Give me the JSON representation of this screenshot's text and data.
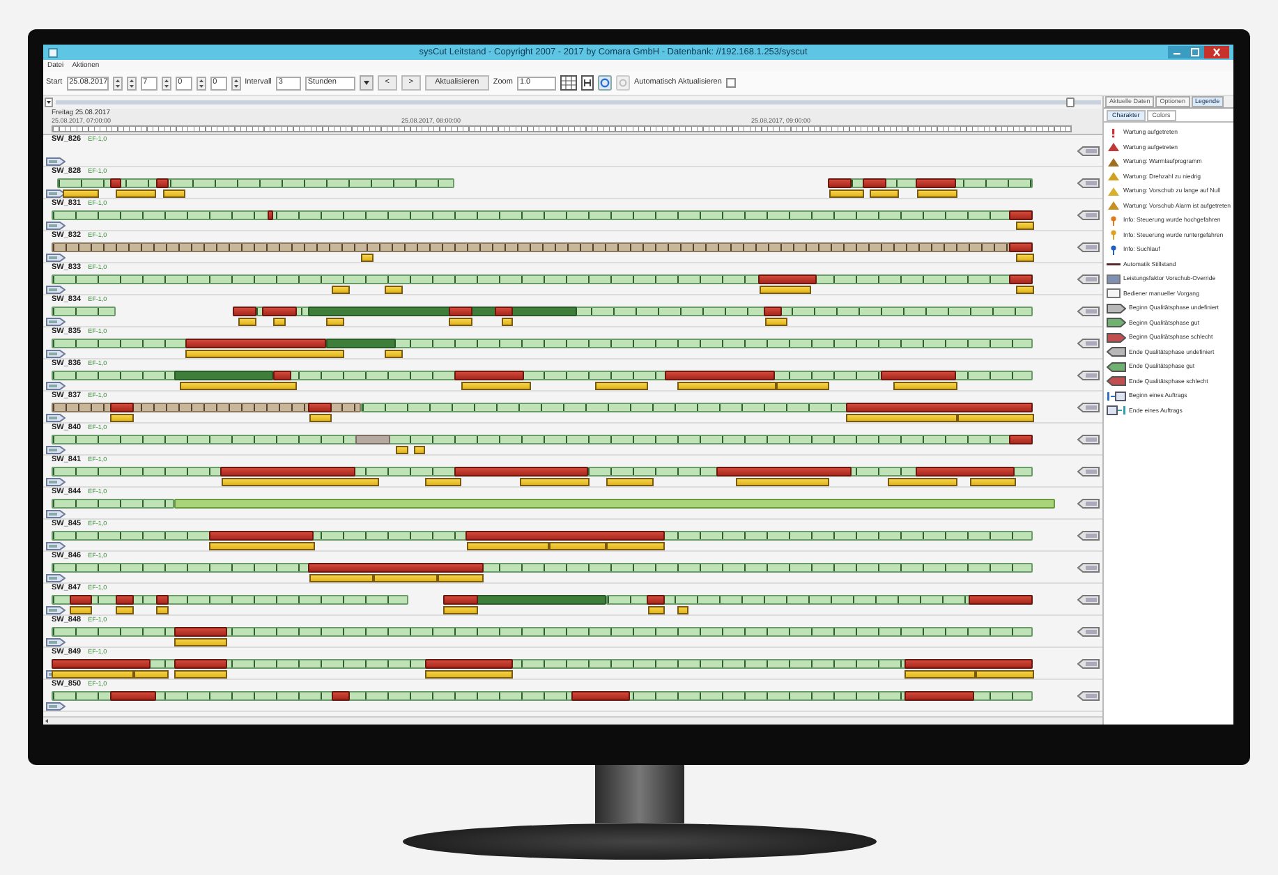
{
  "window": {
    "title": "sysCut Leitstand - Copyright 2007 - 2017 by Comara GmbH - Datenbank: //192.168.1.253/syscut"
  },
  "menu": [
    "Datei",
    "Aktionen"
  ],
  "toolbar": {
    "start_label": "Start",
    "start_date": "25.08.2017",
    "hour": "7",
    "minute": "0",
    "second": "0",
    "interval_label": "Intervall",
    "interval": "3",
    "unit": "Stunden",
    "prev": "<",
    "next": ">",
    "refresh": "Aktualisieren",
    "zoom_label": "Zoom",
    "zoom": "1.0",
    "auto_refresh_label": "Automatisch Aktualisieren",
    "auto_refresh": false
  },
  "time_slider": {
    "level": 0.97
  },
  "timeline": {
    "date": "Freitag 25.08.2017",
    "ticks": [
      "25.08.2017, 07:00:00",
      "25.08.2017, 08:00:00",
      "25.08.2017, 09:00:00"
    ]
  },
  "machines": [
    {
      "name": "SW_826",
      "program": "EF-1,0"
    },
    {
      "name": "SW_828",
      "program": "EF-1,0"
    },
    {
      "name": "SW_831",
      "program": "EF-1,0"
    },
    {
      "name": "SW_832",
      "program": "EF-1,0"
    },
    {
      "name": "SW_833",
      "program": "EF-1,0"
    },
    {
      "name": "SW_834",
      "program": "EF-1,0"
    },
    {
      "name": "SW_835",
      "program": "EF-1,0"
    },
    {
      "name": "SW_836",
      "program": "EF-1,0"
    },
    {
      "name": "SW_837",
      "program": "EF-1,0"
    },
    {
      "name": "SW_840",
      "program": "EF-1,0"
    },
    {
      "name": "SW_841",
      "program": "EF-1,0"
    },
    {
      "name": "SW_844",
      "program": "EF-1,0"
    },
    {
      "name": "SW_845",
      "program": "EF-1,0"
    },
    {
      "name": "SW_846",
      "program": "EF-1,0"
    },
    {
      "name": "SW_847",
      "program": "EF-1,0"
    },
    {
      "name": "SW_848",
      "program": "EF-1,0"
    },
    {
      "name": "SW_849",
      "program": "EF-1,0"
    },
    {
      "name": "SW_850",
      "program": "EF-1,0"
    }
  ],
  "side_panel": {
    "tabs": [
      {
        "label": "Aktuelle Daten",
        "selected": false
      },
      {
        "label": "Optionen",
        "selected": false
      },
      {
        "label": "Legende",
        "selected": true
      }
    ],
    "subtabs": [
      {
        "label": "Charakter",
        "selected": true
      },
      {
        "label": "Colors",
        "selected": false
      }
    ],
    "legend": [
      {
        "kind": "mark",
        "color": "#d03030",
        "label": "Wartung aufgetreten"
      },
      {
        "kind": "warning",
        "color": "#c03838",
        "label": "Wartung aufgetreten"
      },
      {
        "kind": "warning",
        "color": "#a07020",
        "label": "Wartung: Warmlaufprogramm"
      },
      {
        "kind": "warning",
        "color": "#d0a020",
        "label": "Wartung: Drehzahl zu niedrig"
      },
      {
        "kind": "warning",
        "color": "#d8b030",
        "label": "Wartung: Vorschub zu lange auf Null"
      },
      {
        "kind": "warning",
        "color": "#c89020",
        "label": "Wartung: Vorschub Alarm ist aufgetreten"
      },
      {
        "kind": "pin",
        "color": "#e07818",
        "label": "Info: Steuerung wurde hochgefahren"
      },
      {
        "kind": "pin",
        "color": "#e0a020",
        "label": "Info: Steuerung wurde runtergefahren"
      },
      {
        "kind": "pin",
        "color": "#2060c0",
        "label": "Info: Suchlauf"
      },
      {
        "kind": "line",
        "color": "#502020",
        "label": "Automatik Stillstand"
      },
      {
        "kind": "box",
        "color": "#8090b0",
        "label": "Leistungsfaktor Vorschub-Override"
      },
      {
        "kind": "box",
        "color": "#f4f4f4",
        "label": "Bediener manueller Vorgang"
      },
      {
        "kind": "phase_begin",
        "color": "#b8b8b8",
        "label": "Beginn Qualitätsphase undefiniert"
      },
      {
        "kind": "phase_begin",
        "color": "#70b070",
        "label": "Beginn Qualitätsphase gut"
      },
      {
        "kind": "phase_begin",
        "color": "#c05050",
        "label": "Beginn Qualitätsphase schlecht"
      },
      {
        "kind": "phase_end",
        "color": "#b8b8b8",
        "label": "Ende Qualitätsphase undefiniert"
      },
      {
        "kind": "phase_end",
        "color": "#70b070",
        "label": "Ende Qualitätsphase gut"
      },
      {
        "kind": "phase_end",
        "color": "#c05050",
        "label": "Ende Qualitätsphase schlecht"
      },
      {
        "kind": "order_begin",
        "label": "Beginn eines Auftrags"
      },
      {
        "kind": "order_end",
        "label": "Ende eines Auftrags"
      }
    ]
  }
}
